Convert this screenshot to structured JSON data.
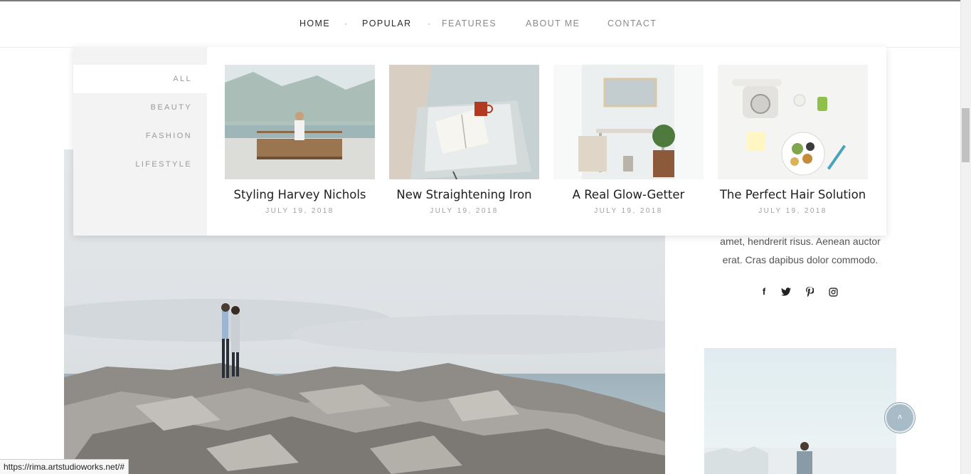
{
  "nav": {
    "items": [
      {
        "label": "HOME",
        "style": "dark"
      },
      {
        "label": "POPULAR",
        "style": "dark"
      },
      {
        "label": "FEATURES",
        "style": "light"
      },
      {
        "label": "ABOUT ME",
        "style": "light"
      },
      {
        "label": "CONTACT",
        "style": "light"
      }
    ],
    "separator": "·"
  },
  "mega_menu": {
    "categories": [
      "ALL",
      "BEAUTY",
      "FASHION",
      "LIFESTYLE"
    ],
    "active_category": "ALL",
    "posts": [
      {
        "title": "Styling Harvey Nichols",
        "date": "JULY 19, 2018"
      },
      {
        "title": "New Straightening Iron",
        "date": "JULY 19, 2018"
      },
      {
        "title": "A Real Glow-Getter",
        "date": "JULY 19, 2018"
      },
      {
        "title": "The Perfect Hair Solution",
        "date": "JULY 19, 2018"
      }
    ]
  },
  "sidebar": {
    "about_partial_lines": [
      "amet, hendrerit risus. Aenean auctor",
      "erat. Cras dapibus dolor commodo."
    ],
    "social_icons": [
      {
        "name": "facebook-icon",
        "glyph": "f"
      },
      {
        "name": "twitter-icon",
        "glyph": "🐦"
      },
      {
        "name": "pinterest-icon",
        "glyph": "P"
      },
      {
        "name": "instagram-icon",
        "glyph": "◎"
      }
    ]
  },
  "back_to_top": {
    "glyph": "˄"
  },
  "status_bar": {
    "url": "https://rima.artstudioworks.net/#"
  },
  "colors": {
    "text_dark": "#2c2c2c",
    "text_light": "#8a8a8a",
    "menu_panel": "#f3f3f3",
    "back_to_top": "#a8bcc8"
  }
}
